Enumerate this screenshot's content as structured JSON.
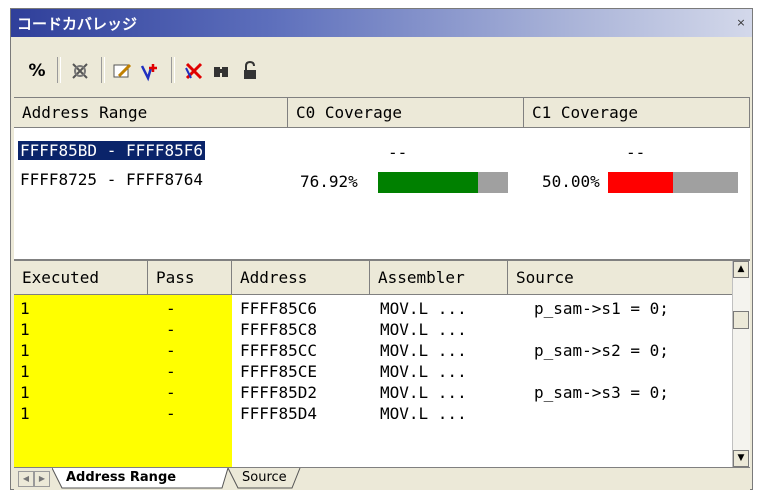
{
  "window": {
    "title": "コードカバレッジ",
    "close_glyph": "×"
  },
  "toolbar": {
    "percent_label": "%",
    "icons": [
      "coverage-settings-icon",
      "edit-range-icon",
      "add-range-icon",
      "delete-range-icon",
      "search-icon",
      "lock-icon"
    ]
  },
  "range_table": {
    "headers": [
      "Address Range",
      "C0 Coverage",
      "C1 Coverage"
    ],
    "rows": [
      {
        "range": "FFFF85BD - FFFF85F6",
        "c0": "--",
        "c1": "--",
        "selected": true
      },
      {
        "range": "FFFF8725 - FFFF8764",
        "c0": "76.92%",
        "c1": "50.00%",
        "c0_fraction": 0.7692,
        "c1_fraction": 0.5,
        "selected": false
      }
    ],
    "colors": {
      "c0_fill": "#008000",
      "c1_fill": "#ff0000",
      "empty": "#a0a0a0"
    }
  },
  "code_table": {
    "headers": [
      "Executed",
      "Pass",
      "Address",
      "Assembler",
      "Source"
    ],
    "rows": [
      {
        "executed": "1",
        "pass": "-",
        "address": "FFFF85C6",
        "assembler": "MOV.L ...",
        "source": "p_sam->s1 = 0;"
      },
      {
        "executed": "1",
        "pass": "-",
        "address": "FFFF85C8",
        "assembler": "MOV.L ...",
        "source": ""
      },
      {
        "executed": "1",
        "pass": "-",
        "address": "FFFF85CC",
        "assembler": "MOV.L ...",
        "source": "p_sam->s2 = 0;"
      },
      {
        "executed": "1",
        "pass": "-",
        "address": "FFFF85CE",
        "assembler": "MOV.L ...",
        "source": ""
      },
      {
        "executed": "1",
        "pass": "-",
        "address": "FFFF85D2",
        "assembler": "MOV.L ...",
        "source": "p_sam->s3 = 0;"
      },
      {
        "executed": "1",
        "pass": "-",
        "address": "FFFF85D4",
        "assembler": "MOV.L ...",
        "source": ""
      }
    ]
  },
  "tabs": [
    {
      "label": "Address Range",
      "active": true
    },
    {
      "label": "Source",
      "active": false
    }
  ]
}
